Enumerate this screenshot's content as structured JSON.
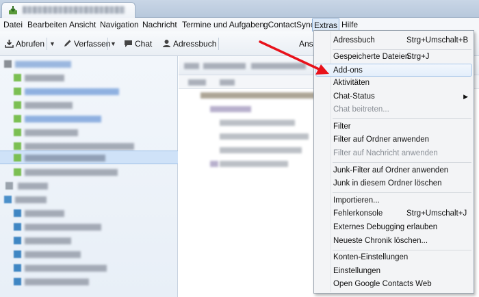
{
  "menubar": {
    "items": [
      "Datei",
      "Bearbeiten",
      "Ansicht",
      "Navigation",
      "Nachricht",
      "Termine und Aufgaben",
      "gContactSync",
      "Extras",
      "Hilfe"
    ],
    "active": "Extras"
  },
  "toolbar": {
    "get_label": "Abrufen",
    "compose_label": "Verfassen",
    "chat_label": "Chat",
    "addressbook_label": "Adressbuch",
    "cut_label": "Ansi"
  },
  "extras_menu": {
    "items": [
      {
        "label": "Adressbuch",
        "accel": "Strg+Umschalt+B"
      },
      {
        "label": "Gespeicherte Dateien",
        "accel": "Strg+J"
      },
      {
        "label": "Add-ons",
        "highlighted": true
      },
      {
        "label": "Aktivitäten"
      },
      {
        "label": "Chat-Status",
        "submenu": true
      },
      {
        "label": "Chat beitreten...",
        "disabled": true
      },
      {
        "label": "Filter"
      },
      {
        "label": "Filter auf Ordner anwenden"
      },
      {
        "label": "Filter auf Nachricht anwenden",
        "disabled": true
      },
      {
        "label": "Junk-Filter auf Ordner anwenden"
      },
      {
        "label": "Junk in diesem Ordner löschen"
      },
      {
        "label": "Importieren..."
      },
      {
        "label": "Fehlerkonsole",
        "accel": "Strg+Umschalt+J"
      },
      {
        "label": "Externes Debugging erlauben"
      },
      {
        "label": "Neueste Chronik löschen..."
      },
      {
        "label": "Konten-Einstellungen"
      },
      {
        "label": "Einstellungen"
      },
      {
        "label": "Open Google Contacts Web"
      }
    ]
  },
  "colors": {
    "annotation_arrow": "#e8121b",
    "menu_hover": "#e3eefb",
    "selection": "#cfe2f8"
  },
  "icons": {
    "get_mail": "download-icon",
    "compose": "pencil-icon",
    "chat": "chat-bubble-icon",
    "addressbook": "person-icon",
    "submenu": "chevron-right-icon"
  }
}
